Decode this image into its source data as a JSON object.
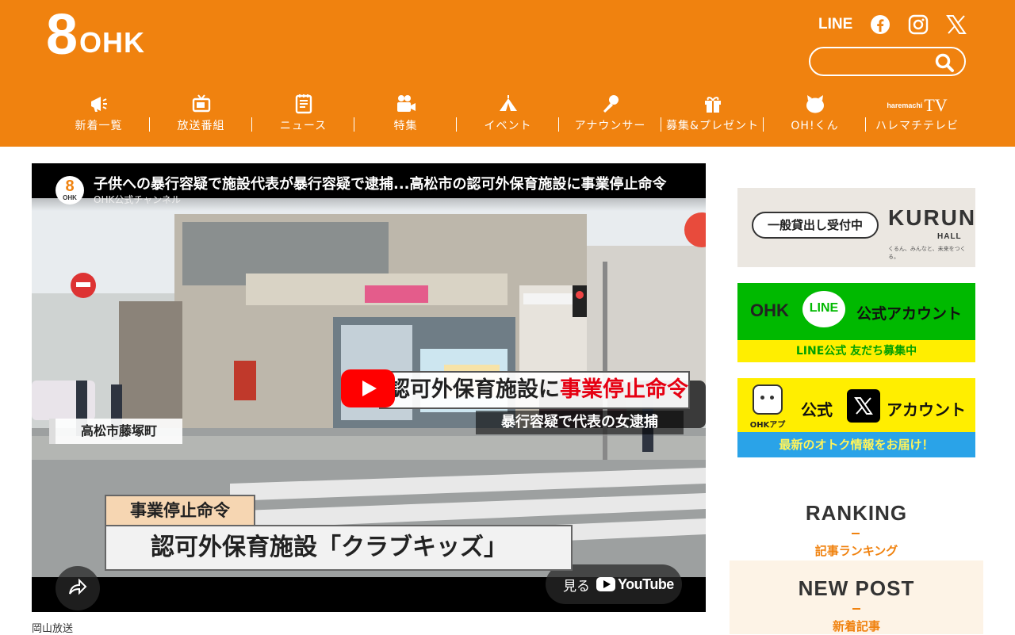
{
  "header": {
    "logo_number": "8",
    "logo_text": "OHK",
    "social": {
      "line_label": "LINE",
      "icons": [
        "facebook-icon",
        "instagram-icon",
        "x-icon"
      ]
    },
    "search": {
      "value": "",
      "placeholder": ""
    }
  },
  "nav": [
    {
      "label": "新着一覧",
      "icon": "megaphone-icon"
    },
    {
      "label": "放送番組",
      "icon": "tv-icon"
    },
    {
      "label": "ニュース",
      "icon": "notepad-icon"
    },
    {
      "label": "特集",
      "icon": "video-camera-icon"
    },
    {
      "label": "イベント",
      "icon": "tent-icon"
    },
    {
      "label": "アナウンサー",
      "icon": "microphone-icon"
    },
    {
      "label": "募集&プレゼント",
      "icon": "gift-icon"
    },
    {
      "label": "OH!くん",
      "icon": "cat-face-icon"
    },
    {
      "label": "ハレマチテレビ",
      "icon": "haremachi-tv-logo",
      "logo_small": "haremachi",
      "logo_big": "TV"
    }
  ],
  "video": {
    "title": "子供への暴行容疑で施設代表が暴行容疑で逮捕...高松市の認可外保育施設に事業停止命令",
    "channel": "OHK公式チャンネル",
    "channel_logo_number": "8",
    "channel_logo_text": "OHK",
    "caption_top_prefix": "認可外保育施設に",
    "caption_top_red": "事業停止命令",
    "caption_sub": "暴行容疑で代表の女逮捕",
    "location": "高松市藤塚町",
    "caption_bottom_1": "事業停止命令",
    "caption_bottom_2": "認可外保育施設「クラブキッズ」",
    "shop_sign": "ッズ",
    "watch_label": "見る",
    "youtube_label": "YouTube"
  },
  "credit": "岡山放送",
  "sidebar": {
    "banner1": {
      "pill": "一般貸出し受付中",
      "brand": "KURUN",
      "brand_sub": "HALL",
      "tagline": "くるん、みんなと、未来をつくる。"
    },
    "banner2": {
      "left": "OHK",
      "bubble": "LINE",
      "right": "公式アカウント",
      "strip": "LINE公式 友だち募集中"
    },
    "banner3": {
      "app_label": "OHKアプリ",
      "left": "公式",
      "right": "アカウント",
      "strip": "最新のオトク情報をお届け！"
    },
    "ranking": {
      "title": "RANKING",
      "subtitle": "記事ランキング"
    },
    "newpost": {
      "title": "NEW POST",
      "subtitle": "新着記事"
    }
  },
  "colors": {
    "brand_orange": "#f0820f",
    "line_green": "#00b900",
    "yellow": "#ffee00",
    "youtube_red": "#ff0000"
  }
}
